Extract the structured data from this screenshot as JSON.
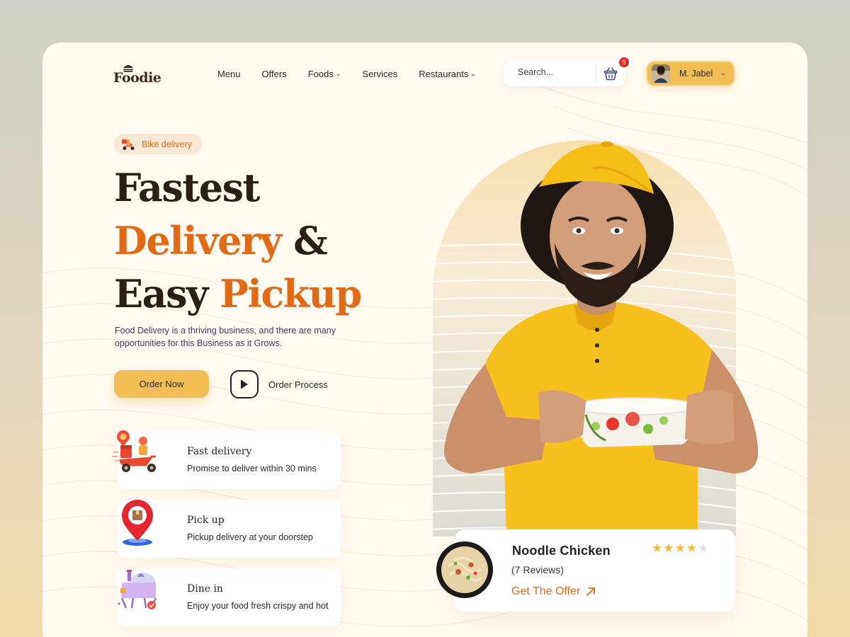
{
  "brand": {
    "name": "Foodie",
    "logo_icon": "burger-icon"
  },
  "nav": {
    "items": [
      {
        "label": "Menu",
        "has_dropdown": false
      },
      {
        "label": "Offers",
        "has_dropdown": false
      },
      {
        "label": "Foods",
        "has_dropdown": true
      },
      {
        "label": "Services",
        "has_dropdown": false
      },
      {
        "label": "Restaurants",
        "has_dropdown": true
      }
    ]
  },
  "search": {
    "placeholder": "Search..."
  },
  "cart": {
    "icon": "basket-icon",
    "count": "5"
  },
  "user": {
    "name": "M. Jabel",
    "avatar_icon": "user-avatar"
  },
  "hero": {
    "pill_label": "Bike delivery",
    "headline": {
      "line1": "Fastest",
      "line2_orange": "Delivery",
      "line2_rest": " &",
      "line3_dark": "Easy ",
      "line3_orange": "Pickup"
    },
    "description": "Food Delivery is a thriving business, and there are many opportunities for this Business as it Grows.",
    "order_button": "Order Now",
    "process_button": "Order Process"
  },
  "features": [
    {
      "title": "Fast delivery",
      "subtitle": "Promise to deliver within 30 mins",
      "icon": "scooter-icon"
    },
    {
      "title": "Pick up",
      "subtitle": "Pickup delivery at your doorstep",
      "icon": "location-pin-icon"
    },
    {
      "title": "Dine in",
      "subtitle": "Enjoy your food fresh crispy and hot",
      "icon": "dining-table-icon"
    }
  ],
  "product_card": {
    "name": "Noodle Chicken",
    "reviews": "(7 Reviews)",
    "rating": 4,
    "rating_max": 5,
    "cta": "Get The Offer"
  },
  "colors": {
    "accent": "#f1bd55",
    "orange": "#e06a16",
    "dark_text": "#2b1f1a",
    "badge_red": "#e4261f",
    "card_bg": "#fffaf1"
  }
}
